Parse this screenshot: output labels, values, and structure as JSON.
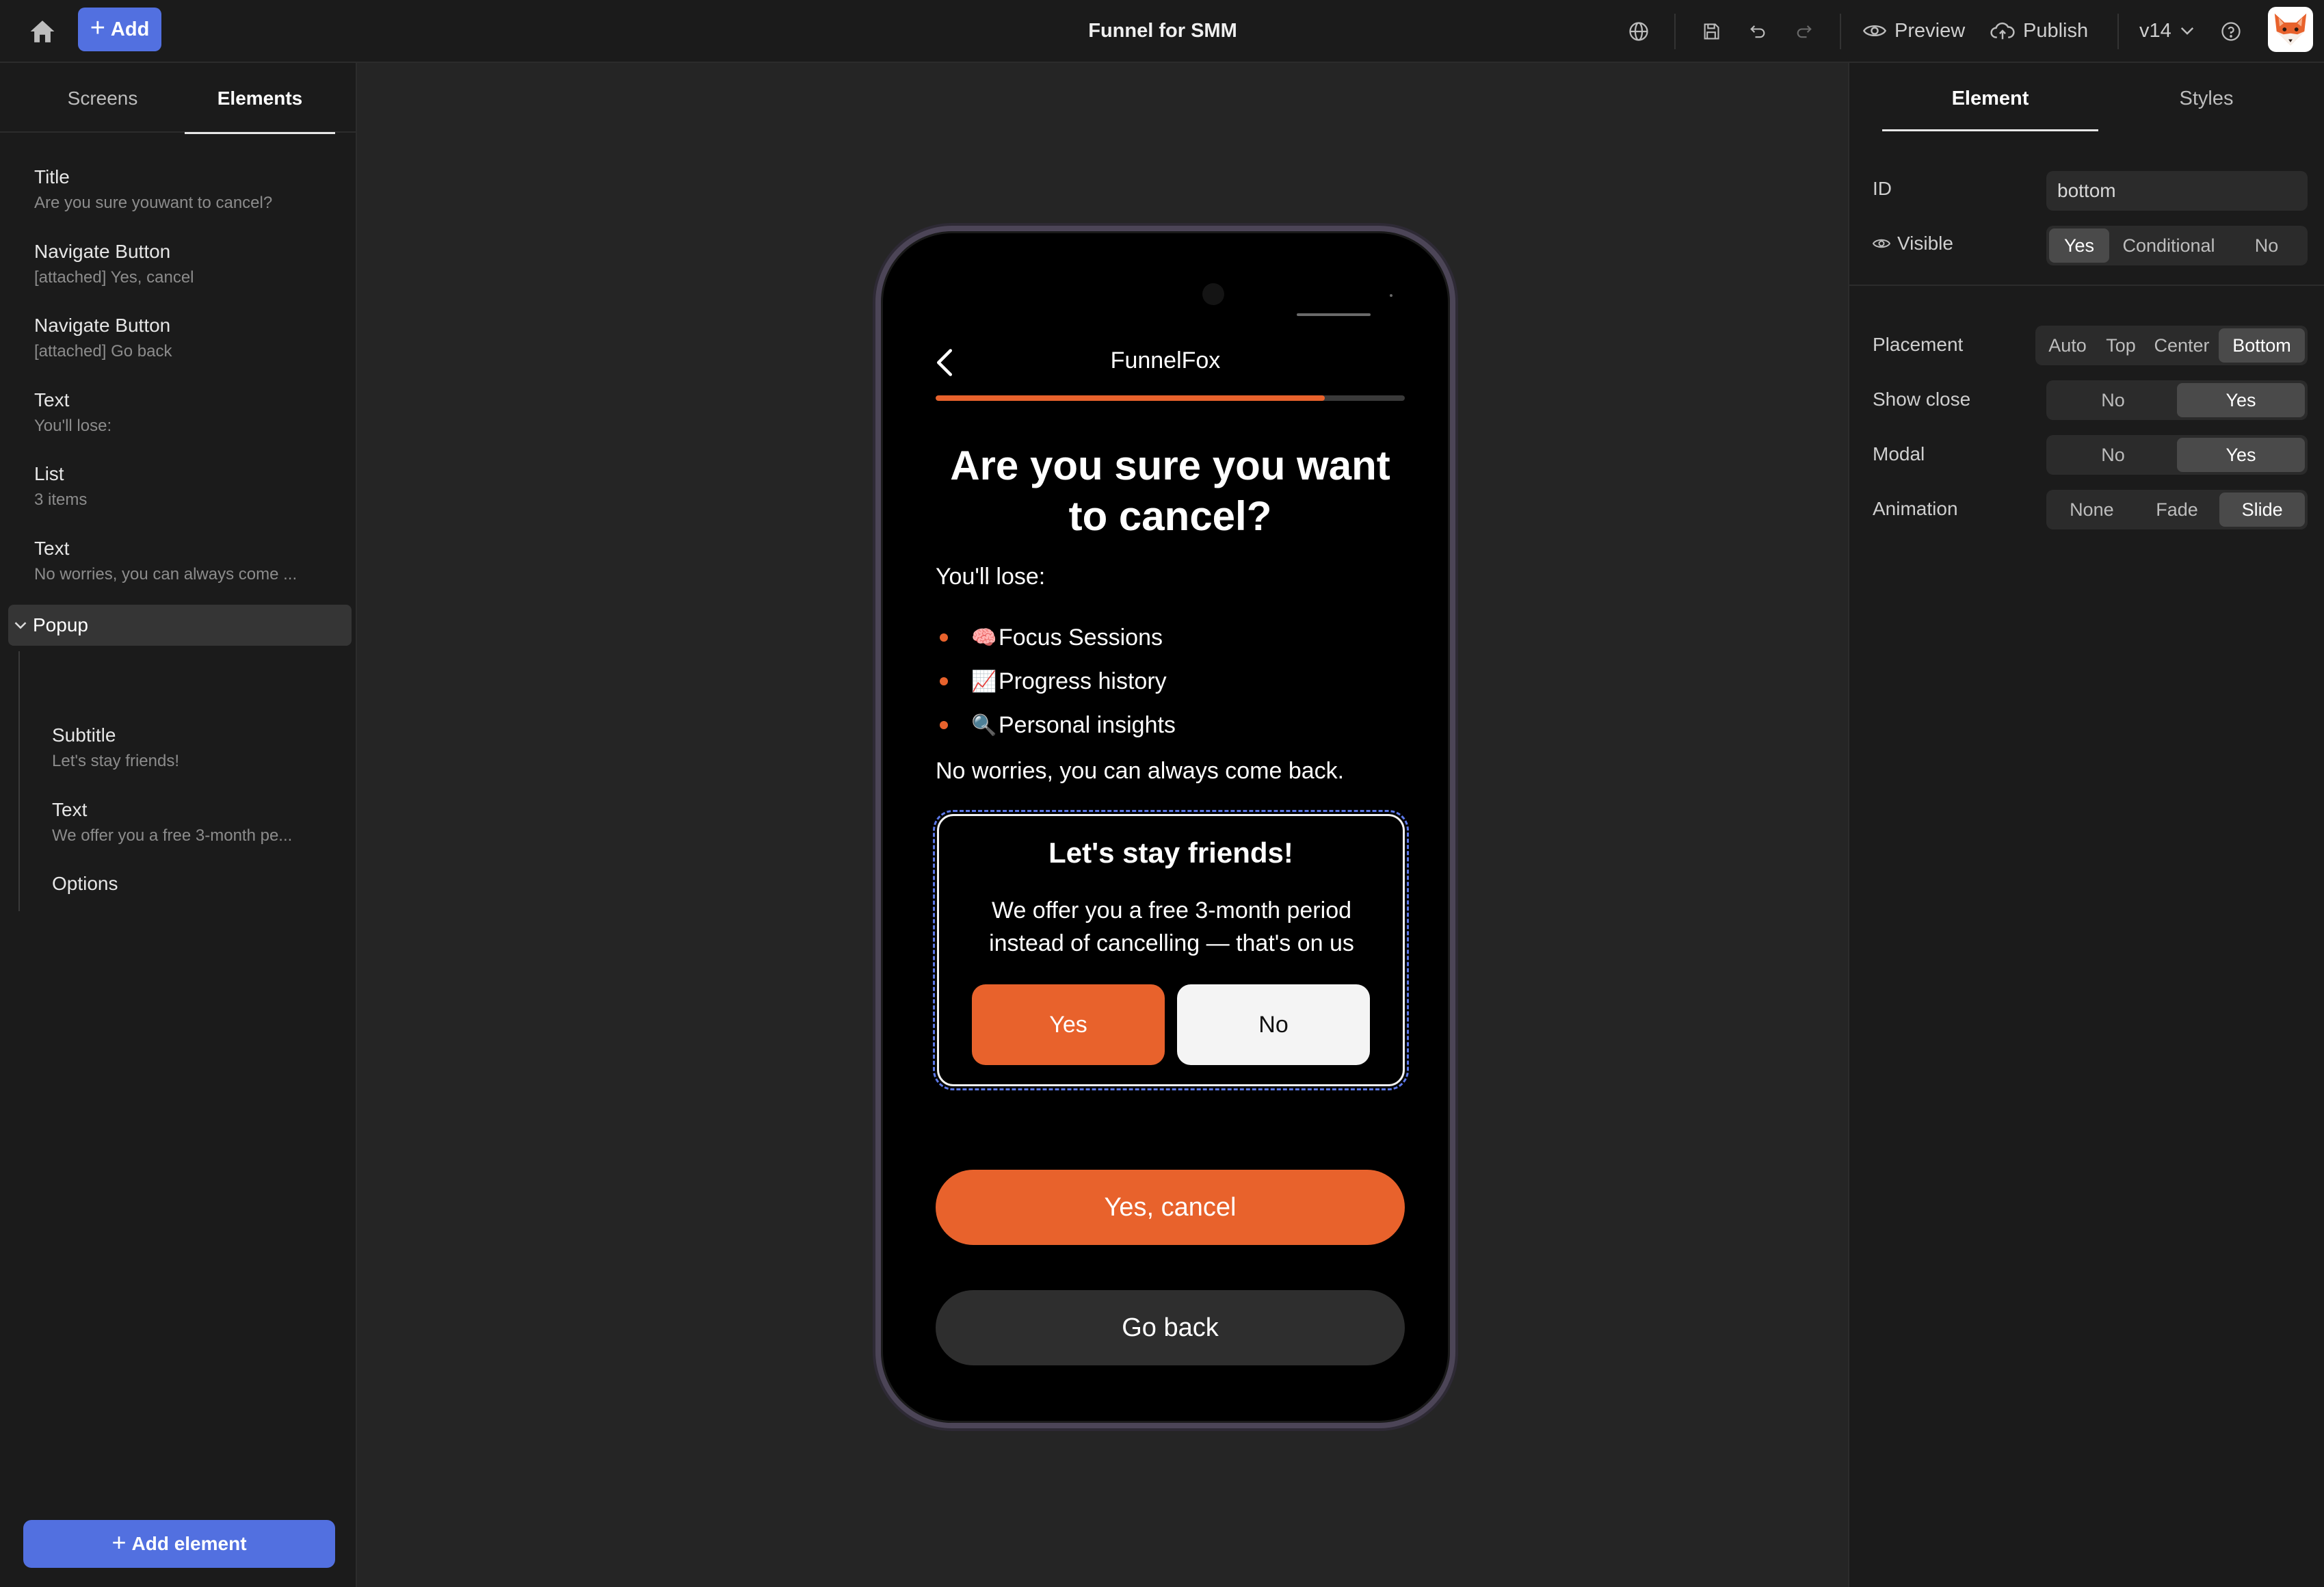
{
  "topbar": {
    "add_label": "Add",
    "title": "Funnel for SMM",
    "preview_label": "Preview",
    "publish_label": "Publish",
    "version": "v14"
  },
  "left_panel": {
    "tabs": [
      "Screens",
      "Elements"
    ],
    "active_tab": "Elements",
    "items": [
      {
        "name": "Title",
        "sub": "Are you sure youwant to cancel?"
      },
      {
        "name": "Navigate Button",
        "sub": "[attached] Yes, cancel"
      },
      {
        "name": "Navigate Button",
        "sub": "[attached] Go back"
      },
      {
        "name": "Text",
        "sub": "You'll lose:"
      },
      {
        "name": "List",
        "sub": "3 items"
      },
      {
        "name": "Text",
        "sub": "No worries, you can always come ..."
      }
    ],
    "popup_label": "Popup",
    "popup_children": [
      {
        "name": "Subtitle",
        "sub": "Let's stay friends!"
      },
      {
        "name": "Text",
        "sub": "We offer you a free 3-month pe..."
      },
      {
        "name": "Options",
        "sub": ""
      }
    ],
    "add_element_label": "Add element"
  },
  "right_panel": {
    "tabs": [
      "Element",
      "Styles"
    ],
    "active_tab": "Element",
    "id_label": "ID",
    "id_value": "bottom",
    "visible_label": "Visible",
    "visible_options": [
      "Yes",
      "Conditional",
      "No"
    ],
    "visible_selected": "Yes",
    "placement_label": "Placement",
    "placement_options": [
      "Auto",
      "Top",
      "Center",
      "Bottom"
    ],
    "placement_selected": "Bottom",
    "show_close_label": "Show close",
    "show_close_options": [
      "No",
      "Yes"
    ],
    "show_close_selected": "Yes",
    "modal_label": "Modal",
    "modal_options": [
      "No",
      "Yes"
    ],
    "modal_selected": "Yes",
    "animation_label": "Animation",
    "animation_options": [
      "None",
      "Fade",
      "Slide"
    ],
    "animation_selected": "Slide"
  },
  "phone": {
    "brand": "FunnelFox",
    "progress_fraction": 0.83,
    "title": "Are you sure you want to cancel?",
    "lose_label": "You'll lose:",
    "list": [
      {
        "emoji": "🧠",
        "text": "Focus Sessions"
      },
      {
        "emoji": "📈",
        "text": "Progress history"
      },
      {
        "emoji": "🔍",
        "text": "Personal insights"
      }
    ],
    "worries": "No worries, you can always come back.",
    "popup": {
      "title": "Let's stay friends!",
      "text": "We offer you a free 3-month period instead of cancelling — that's on us",
      "yes": "Yes",
      "no": "No"
    },
    "cancel_button": "Yes, cancel",
    "back_button": "Go back"
  },
  "colors": {
    "accent": "#e8622c",
    "primary_blue": "#5270e0"
  }
}
